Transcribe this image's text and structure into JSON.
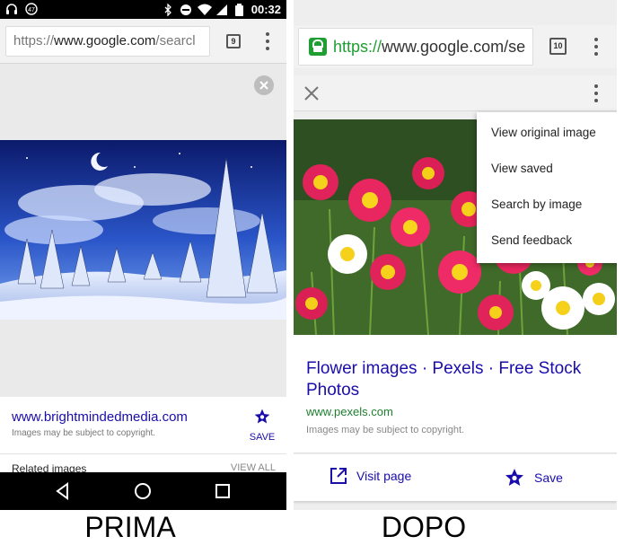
{
  "before": {
    "caption": "PRIMA",
    "status_bar": {
      "time": "00:32"
    },
    "url": {
      "prefix": "https://",
      "host": "www.google.com",
      "rest": "/searcl"
    },
    "tab_count": "9",
    "result": {
      "domain": "www.brightmindedmedia.com",
      "copyright": "Images may be subject to copyright.",
      "save_label": "SAVE"
    },
    "related": {
      "label": "Related images",
      "view_all": "VIEW ALL"
    }
  },
  "after": {
    "caption": "DOPO",
    "url": {
      "prefix": "https://",
      "host": "www.google.com",
      "rest": "/se"
    },
    "tab_count": "10",
    "menu": {
      "items": [
        "View original image",
        "View saved",
        "Search by image",
        "Send feedback"
      ]
    },
    "result": {
      "title": "Flower images · Pexels · Free Stock Photos",
      "url": "www.pexels.com",
      "copyright": "Images may be subject to copyright."
    },
    "actions": {
      "visit_label": "Visit page",
      "save_label": "Save"
    }
  },
  "colors": {
    "link_blue": "#1a0dab",
    "url_green": "#1e7e2e",
    "secure_green": "#1f9e32"
  }
}
